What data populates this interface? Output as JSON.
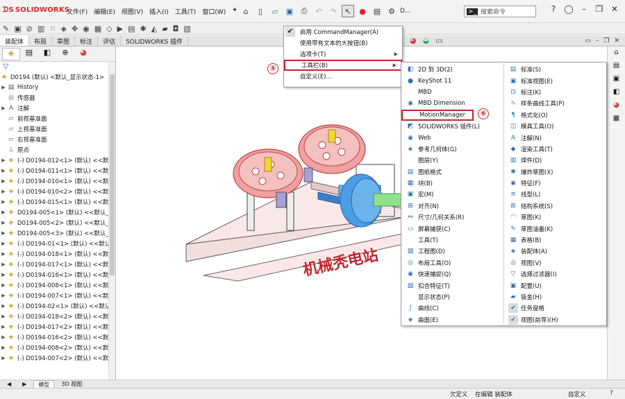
{
  "app": {
    "logo_text": "SOLIDWORKS",
    "menus": [
      "文件(F)",
      "编辑(E)",
      "视图(V)",
      "插入(I)",
      "工具(T)",
      "窗口(W)"
    ],
    "search_placeholder": "搜索命令",
    "doc_label": "D..."
  },
  "tabs": [
    "装配体",
    "布局",
    "草图",
    "标注",
    "评估",
    "SOLIDWORKS 插件"
  ],
  "feature_tree": {
    "root": "D0194 (默认) <默认_显示状态-1>",
    "items": [
      {
        "label": "History",
        "icon": "history-icon",
        "exp": "▶"
      },
      {
        "label": "传感器",
        "icon": "sensor-icon",
        "exp": ""
      },
      {
        "label": "注解",
        "icon": "annotation-icon",
        "exp": "▶"
      },
      {
        "label": "前视基准面",
        "icon": "plane-icon",
        "exp": ""
      },
      {
        "label": "上视基准面",
        "icon": "plane-icon",
        "exp": ""
      },
      {
        "label": "右视基准面",
        "icon": "plane-icon",
        "exp": ""
      },
      {
        "label": "原点",
        "icon": "origin-icon",
        "exp": ""
      },
      {
        "label": "(-) D0194-012<1> (默认) <<默",
        "icon": "part-icon",
        "exp": "▶"
      },
      {
        "label": "(-) D0194-011<1> (默认) <<默",
        "icon": "part-icon",
        "exp": "▶"
      },
      {
        "label": "(-) D0194-010<1> (默认) <<默",
        "icon": "part-icon",
        "exp": "▶"
      },
      {
        "label": "(-) D0194-010<2> (默认) <<默",
        "icon": "part-icon",
        "exp": "▶"
      },
      {
        "label": "(-) D0194-015<1> (默认) <<默",
        "icon": "part-icon",
        "exp": "▶"
      },
      {
        "label": "D0194-005<1> (默认) <<默认_",
        "icon": "part-icon",
        "exp": "▶"
      },
      {
        "label": "D0194-005<2> (默认) <<默认_",
        "icon": "part-icon",
        "exp": "▶"
      },
      {
        "label": "D0194-005<3> (默认) <<默认_",
        "icon": "part-icon",
        "exp": "▶"
      },
      {
        "label": "(-) D0194-01<1> (默认) <<默认_",
        "icon": "part-icon",
        "exp": "▶"
      },
      {
        "label": "(-) D0194-018<1> (默认) <<默",
        "icon": "part-icon",
        "exp": "▶"
      },
      {
        "label": "(-) D0194-017<1> (默认) <<默",
        "icon": "part-icon",
        "exp": "▶"
      },
      {
        "label": "(-) D0194-016<1> (默认) <<默",
        "icon": "part-icon",
        "exp": "▶"
      },
      {
        "label": "(-) D0194-008<1> (默认) <<默",
        "icon": "part-icon",
        "exp": "▶"
      },
      {
        "label": "(-) D0194-007<1> (默认) <<默",
        "icon": "part-icon",
        "exp": "▶"
      },
      {
        "label": "(-) D0194-02<1> (默认) <<默认_",
        "icon": "part-icon",
        "exp": "▶"
      },
      {
        "label": "(-) D0194-018<2> (默认) <<默",
        "icon": "part-icon",
        "exp": "▶"
      },
      {
        "label": "(-) D0194-017<2> (默认) <<默",
        "icon": "part-icon",
        "exp": "▶"
      },
      {
        "label": "(-) D0194-016<2> (默认) <<默",
        "icon": "part-icon",
        "exp": "▶"
      },
      {
        "label": "(-) D0194-008<2> (默认) <<默",
        "icon": "part-icon",
        "exp": "▶"
      },
      {
        "label": "(-) D0194-007<2> (默认) <<默",
        "icon": "part-icon",
        "exp": "▶"
      }
    ]
  },
  "model_tabs": [
    "模型",
    "3D 视图"
  ],
  "status": {
    "left": "欠定义",
    "mid": "在编辑 装配体",
    "right": "自定义"
  },
  "context_menu": {
    "items": [
      {
        "label": "启用 CommandManager(A)",
        "checked": true,
        "submenu": false
      },
      {
        "label": "使用带有文本的大按钮(B)",
        "checked": false,
        "submenu": false
      },
      {
        "label": "选项卡(T)",
        "checked": false,
        "submenu": true
      },
      {
        "label": "工具栏(B)",
        "checked": false,
        "submenu": true
      },
      {
        "label": "自定义(E)...",
        "checked": false,
        "submenu": false
      }
    ]
  },
  "toolbar_menu": {
    "left": [
      {
        "label": "2D 到 3D(2)",
        "icon": "2d-to-3d-icon",
        "glyph": "◧"
      },
      {
        "label": "KeyShot 11",
        "icon": "keyshot-icon",
        "glyph": "●"
      },
      {
        "label": "MBD",
        "icon": "",
        "glyph": ""
      },
      {
        "label": "MBD Dimension",
        "icon": "mbd-dimension-icon",
        "glyph": "◉"
      },
      {
        "label": "MotionManager",
        "icon": "",
        "glyph": ""
      },
      {
        "label": "SOLIDWORKS 插件(L)",
        "icon": "addin-icon",
        "glyph": "◩"
      },
      {
        "label": "Web",
        "icon": "web-icon",
        "glyph": "◉"
      },
      {
        "label": "参考几何体(G)",
        "icon": "ref-geometry-icon",
        "glyph": "◈"
      },
      {
        "label": "图层(Y)",
        "icon": "",
        "glyph": ""
      },
      {
        "label": "图纸格式",
        "icon": "sheet-format-icon",
        "glyph": "▤"
      },
      {
        "label": "块(B)",
        "icon": "block-icon",
        "glyph": "▦"
      },
      {
        "label": "宏(M)",
        "icon": "macro-icon",
        "glyph": "▣"
      },
      {
        "label": "对齐(N)",
        "icon": "align-icon",
        "glyph": "⊞"
      },
      {
        "label": "尺寸/几何关系(R)",
        "icon": "dimension-icon",
        "glyph": "⇔"
      },
      {
        "label": "屏幕捕获(C)",
        "icon": "screen-capture-icon",
        "glyph": "▭"
      },
      {
        "label": "工具(T)",
        "icon": "",
        "glyph": ""
      },
      {
        "label": "工程图(D)",
        "icon": "drawing-icon",
        "glyph": "▧"
      },
      {
        "label": "布局工具(O)",
        "icon": "layout-tools-icon",
        "glyph": "◎"
      },
      {
        "label": "快速捕捉(Q)",
        "icon": "quick-snap-icon",
        "glyph": "◉"
      },
      {
        "label": "扣合特征(T)",
        "icon": "fastening-icon",
        "glyph": "▨"
      },
      {
        "label": "显示状态(P)",
        "icon": "",
        "glyph": ""
      },
      {
        "label": "曲线(C)",
        "icon": "curve-icon",
        "glyph": "∫"
      },
      {
        "label": "曲面(E)",
        "icon": "surface-icon",
        "glyph": "◈"
      }
    ],
    "right": [
      {
        "label": "标准(S)",
        "icon": "standard-icon",
        "glyph": "▤",
        "checked": false
      },
      {
        "label": "标准视图(E)",
        "icon": "standard-views-icon",
        "glyph": "▣",
        "checked": false
      },
      {
        "label": "标注(K)",
        "icon": "dimxpert-icon",
        "glyph": "⊡",
        "checked": false
      },
      {
        "label": "样条曲线工具(P)",
        "icon": "spline-icon",
        "glyph": "∿",
        "checked": false
      },
      {
        "label": "格式化(O)",
        "icon": "format-icon",
        "glyph": "¶",
        "checked": false
      },
      {
        "label": "模具工具(O)",
        "icon": "mold-tools-icon",
        "glyph": "◫",
        "checked": false
      },
      {
        "label": "注解(N)",
        "icon": "annotation-icon",
        "glyph": "A",
        "checked": false
      },
      {
        "label": "渲染工具(T)",
        "icon": "render-tools-icon",
        "glyph": "◆",
        "checked": false
      },
      {
        "label": "焊件(D)",
        "icon": "weldments-icon",
        "glyph": "▥",
        "checked": false
      },
      {
        "label": "爆炸草图(X)",
        "icon": "explode-sketch-icon",
        "glyph": "✱",
        "checked": false
      },
      {
        "label": "特征(F)",
        "icon": "features-icon",
        "glyph": "◉",
        "checked": false
      },
      {
        "label": "线型(L)",
        "icon": "line-format-icon",
        "glyph": "≡",
        "checked": false
      },
      {
        "label": "结构系统(S)",
        "icon": "structure-system-icon",
        "glyph": "⊞",
        "checked": false
      },
      {
        "label": "草图(K)",
        "icon": "sketch-icon",
        "glyph": "◠",
        "checked": false
      },
      {
        "label": "草图油墨(K)",
        "icon": "sketch-ink-icon",
        "glyph": "✎",
        "checked": false
      },
      {
        "label": "表格(B)",
        "icon": "table-icon",
        "glyph": "▦",
        "checked": false
      },
      {
        "label": "装配体(A)",
        "icon": "assembly-icon",
        "glyph": "◈",
        "checked": false
      },
      {
        "label": "视图(V)",
        "icon": "view-icon",
        "glyph": "◎",
        "checked": false
      },
      {
        "label": "选择过滤器(I)",
        "icon": "selection-filter-icon",
        "glyph": "▽",
        "checked": false
      },
      {
        "label": "配置(U)",
        "icon": "configuration-icon",
        "glyph": "▣",
        "checked": false
      },
      {
        "label": "钣金(H)",
        "icon": "sheet-metal-icon",
        "glyph": "▰",
        "checked": false
      },
      {
        "label": "任务窗格",
        "icon": "",
        "glyph": "✔",
        "checked": true
      },
      {
        "label": "视图(前导)(H)",
        "icon": "",
        "glyph": "✔",
        "checked": true
      }
    ]
  },
  "callouts": [
    "⑤",
    "⑥"
  ],
  "model_watermark": "机械秃电站",
  "colors": {
    "accent_red": "#c0262b",
    "gear": "#e8a7a0",
    "shaft": "#5aa3e0"
  }
}
